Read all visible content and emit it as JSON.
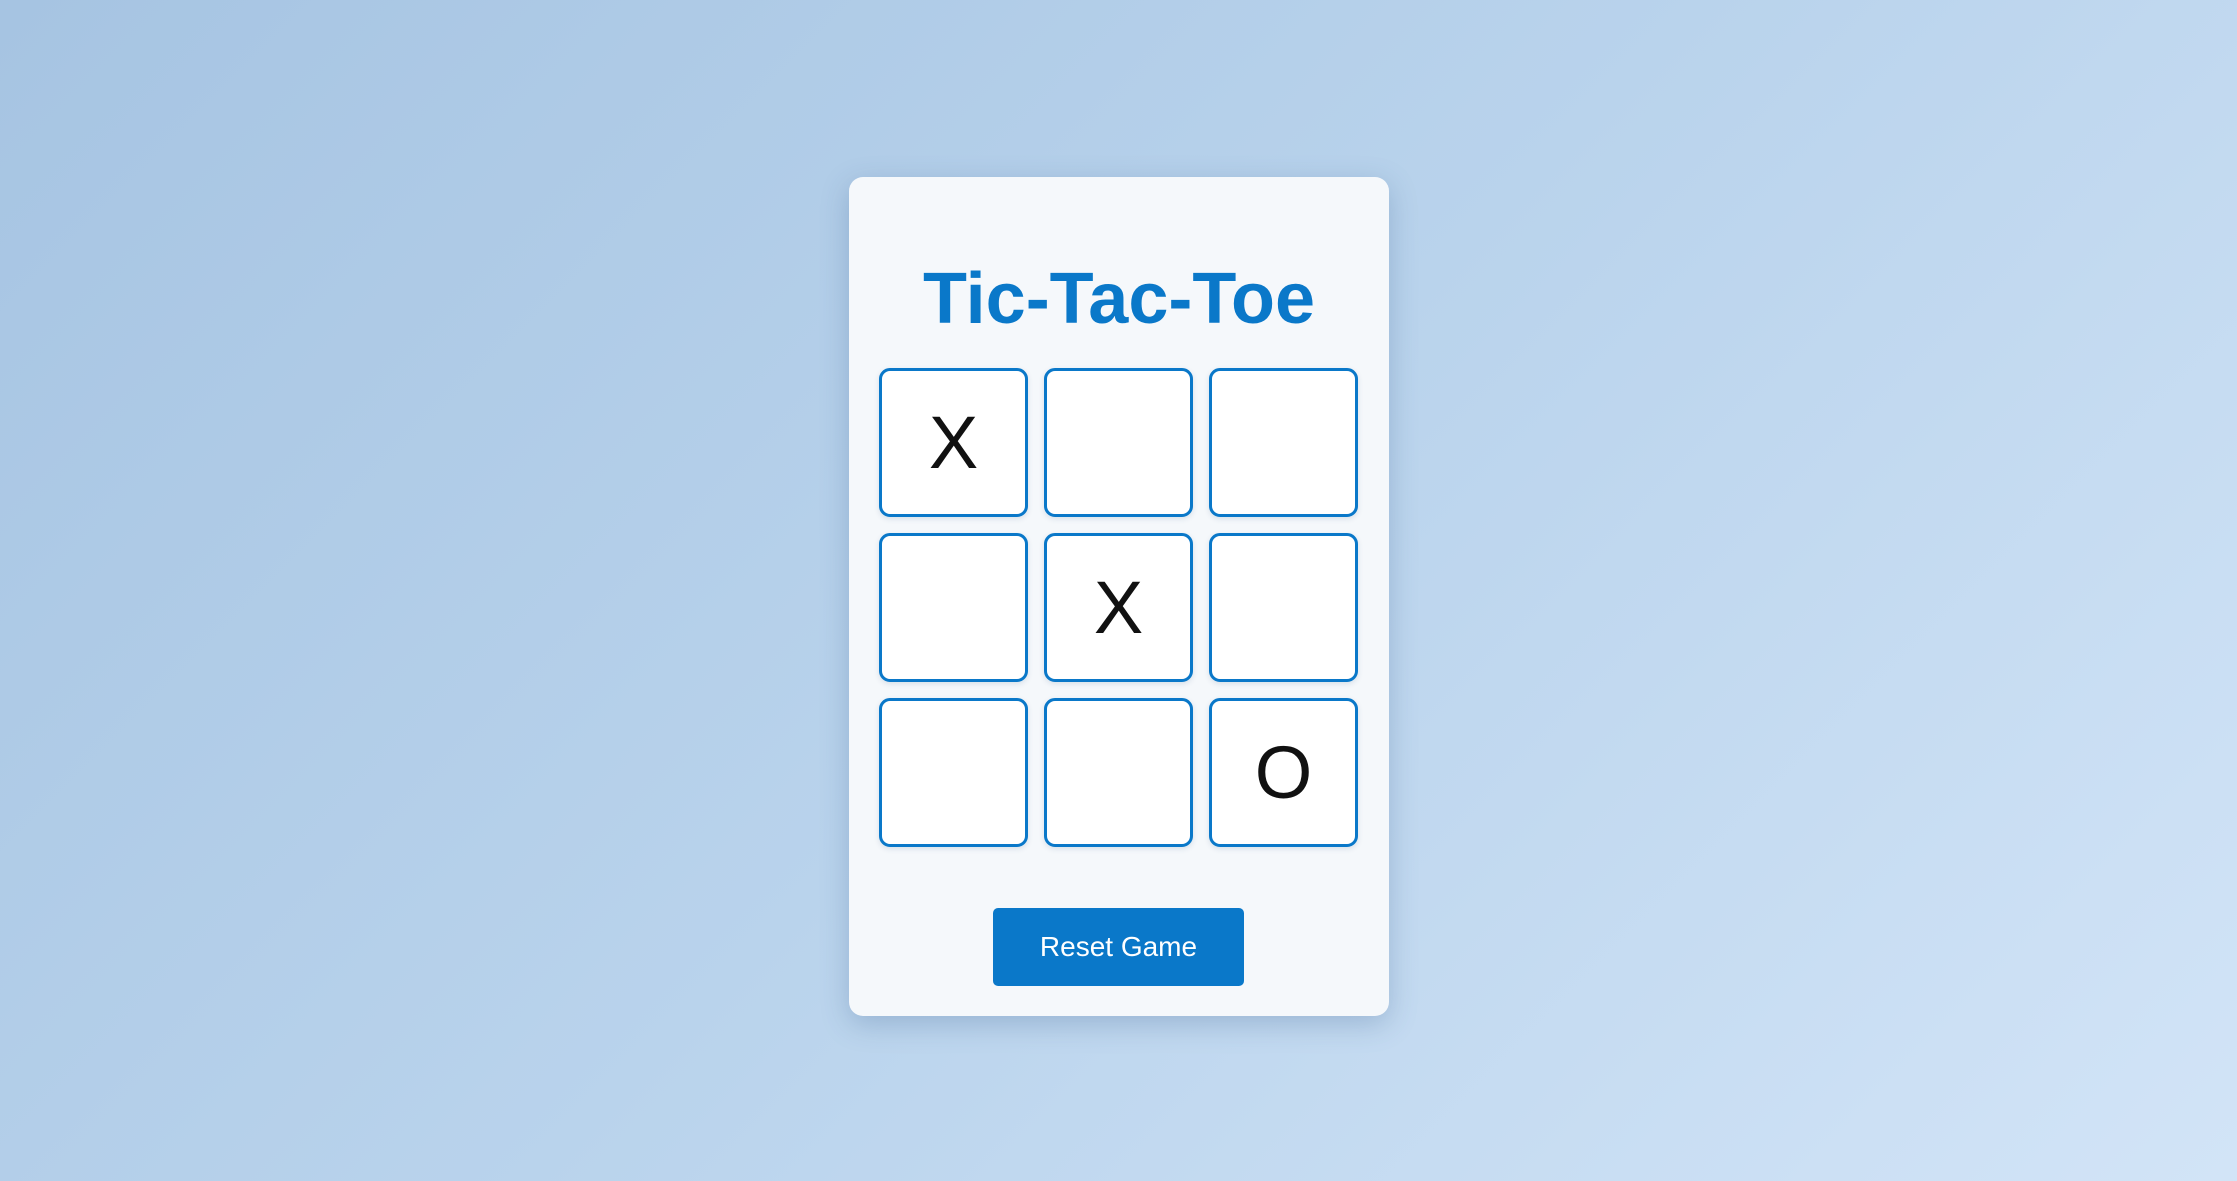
{
  "game": {
    "title": "Tic-Tac-Toe",
    "board": [
      [
        "X",
        "",
        ""
      ],
      [
        "",
        "X",
        ""
      ],
      [
        "",
        "",
        "O"
      ]
    ],
    "reset_label": "Reset Game"
  },
  "colors": {
    "accent": "#0a78c9",
    "card_background": "#f5f8fb",
    "cell_background": "#ffffff",
    "mark": "#111111"
  }
}
